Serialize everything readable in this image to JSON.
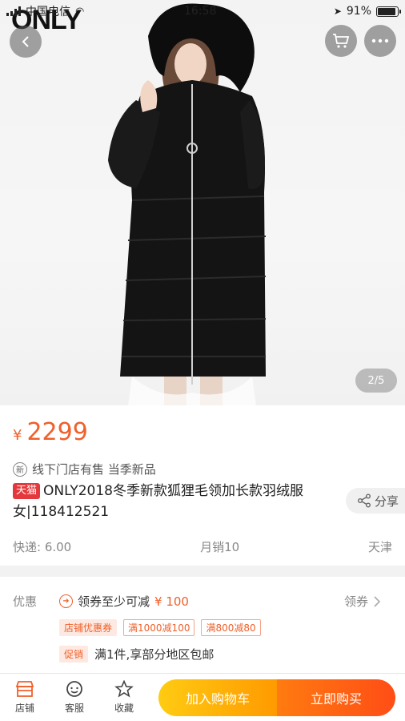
{
  "status_bar": {
    "carrier": "中国电信",
    "time": "16:58",
    "battery": "91%"
  },
  "hero": {
    "brand": "ONLY",
    "page_indicator": "2/5"
  },
  "product": {
    "currency": "¥",
    "price": "2299",
    "store_tag": "线下门店有售 当季新品",
    "new_icon": "新",
    "tmall_badge": "天猫",
    "title": "ONLY2018冬季新款狐狸毛领加长款羽绒服女|118412521",
    "share_label": "分享",
    "shipping": "快递: 6.00",
    "monthly_sales": "月销10",
    "location": "天津"
  },
  "coupons": {
    "label": "优惠",
    "main_text": "领券至少可减",
    "main_amount": "¥ 100",
    "claim_label": "领券",
    "chips": [
      "店铺优惠券",
      "满1000减100",
      "满800减80"
    ],
    "promo_chip": "促销",
    "promo_text": "满1件,享部分地区包邮"
  },
  "bottom_bar": {
    "store_label": "店铺",
    "service_label": "客服",
    "favorite_label": "收藏",
    "add_cart_label": "加入购物车",
    "buy_now_label": "立即购买"
  },
  "colors": {
    "accent": "#f0602b",
    "cart_btn": "#ff9a00",
    "buy_btn": "#ff4d16",
    "tmall_red": "#e4393c"
  }
}
